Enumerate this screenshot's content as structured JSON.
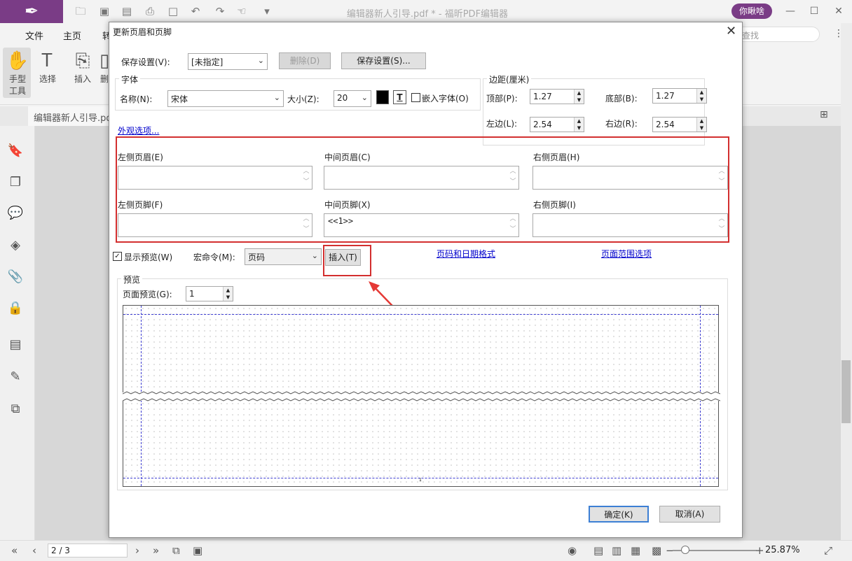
{
  "app": {
    "title": "编辑器新人引导.pdf * - 福昕PDF编辑器",
    "user": "你瞅啥",
    "search_placeholder": "查找",
    "brand_color": "#7a3c86"
  },
  "menu": [
    "文件",
    "主页",
    "转"
  ],
  "ribbon": [
    {
      "label": "手型\n工具",
      "icon": "hand-icon"
    },
    {
      "label": "选择",
      "icon": "select-icon"
    },
    {
      "label": "插入",
      "icon": "insert-icon"
    },
    {
      "label": "删",
      "icon": "delete-icon"
    }
  ],
  "doc_tab": "编辑器新人引导.pdf",
  "status": {
    "page": "2 / 3",
    "zoom": "25.87%"
  },
  "dialog": {
    "title": "更新页眉和页脚",
    "save_settings_label": "保存设置(V):",
    "save_settings_value": "[未指定]",
    "delete_btn": "删除(D)",
    "save_btn": "保存设置(S)...",
    "font_group": "字体",
    "font_name_label": "名称(N):",
    "font_name_value": "宋体",
    "size_label": "大小(Z):",
    "size_value": "20",
    "text_color": "#000000",
    "underline_btn": "T",
    "embed_font_label": "嵌入字体(O)",
    "margin_group": "边距(厘米)",
    "top_label": "顶部(P):",
    "top_value": "1.27",
    "bottom_label": "底部(B):",
    "bottom_value": "1.27",
    "left_label": "左边(L):",
    "left_value": "2.54",
    "right_label": "右边(R):",
    "right_value": "2.54",
    "appearance_link": "外观选项...",
    "left_header_label": "左侧页眉(E)",
    "center_header_label": "中间页眉(C)",
    "right_header_label": "右侧页眉(H)",
    "left_footer_label": "左侧页脚(F)",
    "center_footer_label": "中间页脚(X)",
    "right_footer_label": "右侧页脚(I)",
    "left_header_value": "",
    "center_header_value": "",
    "right_header_value": "",
    "left_footer_value": "",
    "center_footer_value": "<<1>>",
    "right_footer_value": "",
    "show_preview_label": "显示预览(W)",
    "macro_label": "宏命令(M):",
    "macro_value": "页码",
    "insert_btn": "插入(T)",
    "page_date_link": "页码和日期格式",
    "page_range_link": "页面范围选项",
    "preview_group": "预览",
    "page_preview_label": "页面预览(G):",
    "page_preview_value": "1",
    "preview_footer_text": "1",
    "ok_btn": "确定(K)",
    "cancel_btn": "取消(A)",
    "highlight_color": "#d32f2f"
  }
}
